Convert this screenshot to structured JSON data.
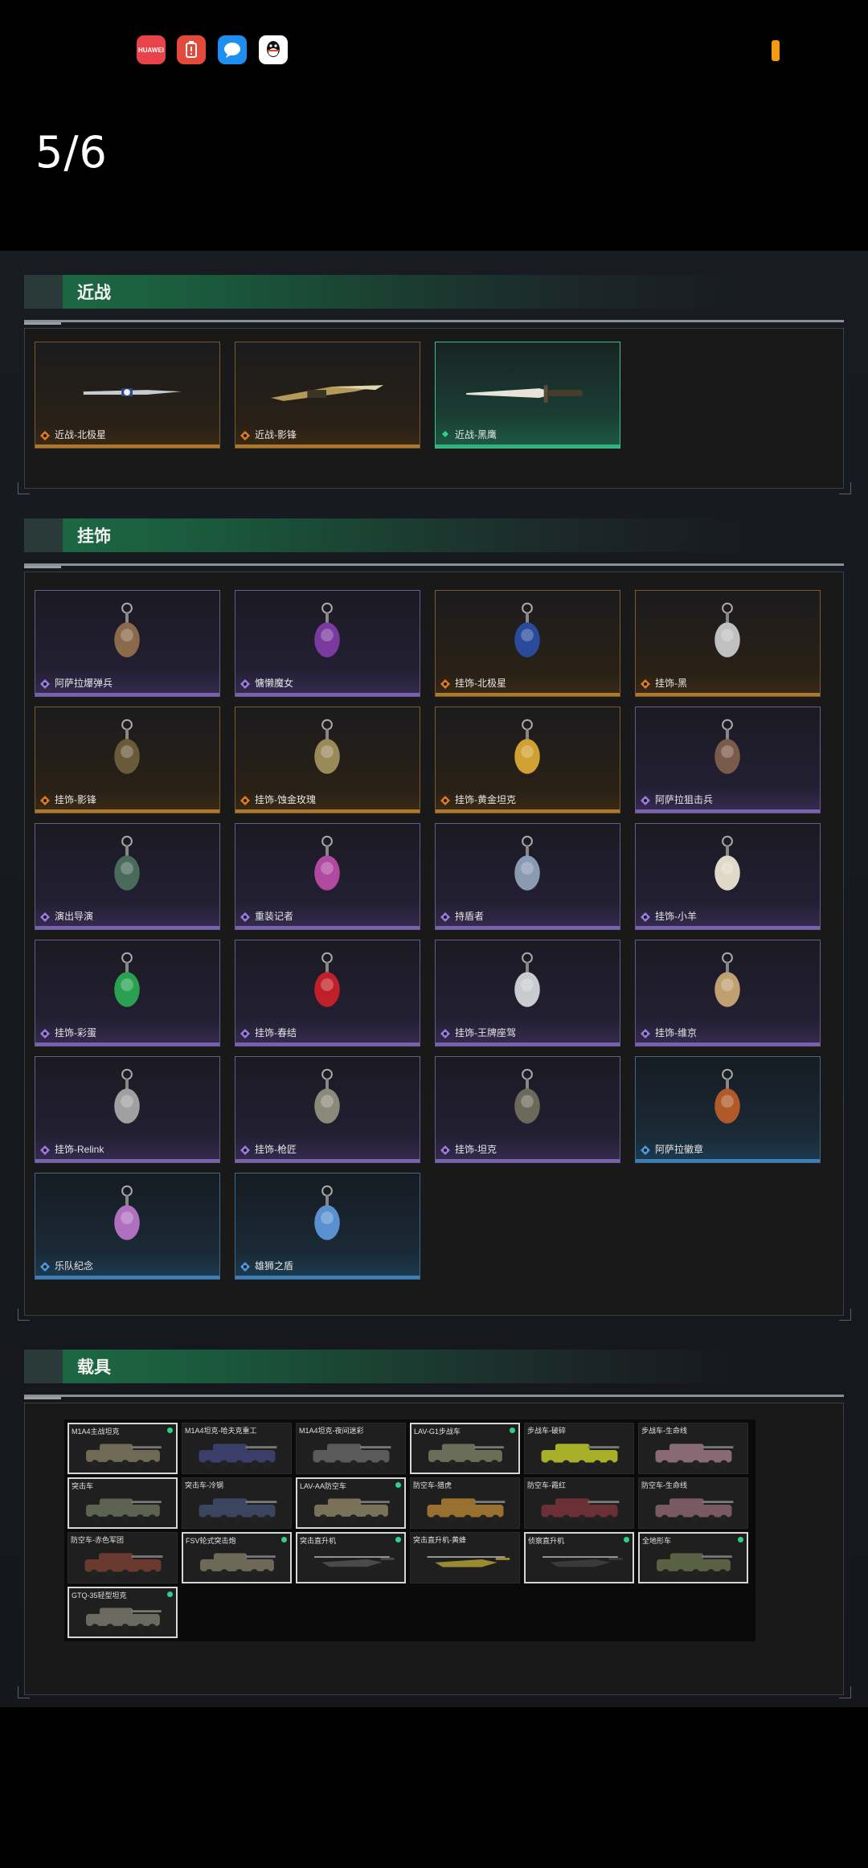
{
  "status_bar": {
    "icons": [
      {
        "name": "huawei-store-icon",
        "text": "HUAWEI",
        "color": "#e8424a"
      },
      {
        "name": "battery-alert-app-icon",
        "text": "",
        "color": "#e44a3c"
      },
      {
        "name": "messages-app-icon",
        "text": "",
        "color": "#1e8ff0"
      },
      {
        "name": "qq-app-icon",
        "text": "",
        "color": "#ffffff"
      }
    ],
    "battery_color": "#f39a12"
  },
  "page_counter": "5/6",
  "sections": {
    "melee": {
      "title": "近战",
      "items": [
        {
          "label": "近战-北极星",
          "rarity": "orange"
        },
        {
          "label": "近战-影锋",
          "rarity": "orange"
        },
        {
          "label": "近战-黑鹰",
          "rarity": "green"
        }
      ]
    },
    "charms": {
      "title": "挂饰",
      "items": [
        {
          "label": "阿萨拉爆弹兵",
          "rarity": "purple"
        },
        {
          "label": "慵懒魔女",
          "rarity": "purple"
        },
        {
          "label": "挂饰-北极星",
          "rarity": "orange"
        },
        {
          "label": "挂饰-黑",
          "rarity": "orange"
        },
        {
          "label": "挂饰-影锋",
          "rarity": "orange"
        },
        {
          "label": "挂饰-蚀金玫瑰",
          "rarity": "orange"
        },
        {
          "label": "挂饰-黄金坦克",
          "rarity": "orange"
        },
        {
          "label": "阿萨拉狙击兵",
          "rarity": "purple"
        },
        {
          "label": "演出导演",
          "rarity": "purple"
        },
        {
          "label": "重装记者",
          "rarity": "purple"
        },
        {
          "label": "持盾者",
          "rarity": "purple"
        },
        {
          "label": "挂饰-小羊",
          "rarity": "purple"
        },
        {
          "label": "挂饰-彩蛋",
          "rarity": "purple"
        },
        {
          "label": "挂饰-春结",
          "rarity": "purple"
        },
        {
          "label": "挂饰-王牌座驾",
          "rarity": "purple"
        },
        {
          "label": "挂饰-维京",
          "rarity": "purple"
        },
        {
          "label": "挂饰-Relink",
          "rarity": "purple"
        },
        {
          "label": "挂饰-枪匠",
          "rarity": "purple"
        },
        {
          "label": "挂饰-坦克",
          "rarity": "purple"
        },
        {
          "label": "阿萨拉徽章",
          "rarity": "blue"
        },
        {
          "label": "乐队纪念",
          "rarity": "blue"
        },
        {
          "label": "雄狮之盾",
          "rarity": "blue"
        }
      ]
    },
    "vehicles": {
      "title": "载具",
      "items": [
        {
          "label": "M1A4主战坦克",
          "dot": true,
          "selected": true,
          "tint": "#6e6a55"
        },
        {
          "label": "M1A4坦克-哈夫克重工",
          "dot": false,
          "selected": false,
          "tint": "#3a3f6a"
        },
        {
          "label": "M1A4坦克-夜间迷彩",
          "dot": false,
          "selected": false,
          "tint": "#5a5a5a"
        },
        {
          "label": "LAV-G1步战车",
          "dot": true,
          "selected": true,
          "tint": "#6a6e58"
        },
        {
          "label": "步战车-破碎",
          "dot": false,
          "selected": false,
          "tint": "#a8b02a"
        },
        {
          "label": "步战车-生命线",
          "dot": false,
          "selected": false,
          "tint": "#8a6a72"
        },
        {
          "label": "突击车",
          "dot": false,
          "selected": true,
          "tint": "#5e6250"
        },
        {
          "label": "突击车-冷钢",
          "dot": false,
          "selected": false,
          "tint": "#3a4660"
        },
        {
          "label": "LAV-AA防空车",
          "dot": true,
          "selected": true,
          "tint": "#7a7258"
        },
        {
          "label": "防空车-猎虎",
          "dot": false,
          "selected": false,
          "tint": "#9a7030"
        },
        {
          "label": "防空车-霞红",
          "dot": false,
          "selected": false,
          "tint": "#6a3036"
        },
        {
          "label": "防空车-生命线",
          "dot": false,
          "selected": false,
          "tint": "#7a5a62"
        },
        {
          "label": "防空车-赤色军团",
          "dot": false,
          "selected": false,
          "tint": "#6a3a30"
        },
        {
          "label": "FSV轮式突击炮",
          "dot": true,
          "selected": true,
          "tint": "#6e6858"
        },
        {
          "label": "突击直升机",
          "dot": true,
          "selected": true,
          "tint": "#4a4a48"
        },
        {
          "label": "突击直升机-黄蜂",
          "dot": false,
          "selected": false,
          "tint": "#9a8a30"
        },
        {
          "label": "侦察直升机",
          "dot": true,
          "selected": true,
          "tint": "#3a3a3a"
        },
        {
          "label": "全地形车",
          "dot": true,
          "selected": true,
          "tint": "#5a6044"
        },
        {
          "label": "GTQ-35轻型坦克",
          "dot": true,
          "selected": true,
          "tint": "#6a6a60"
        }
      ]
    }
  },
  "colors": {
    "accent_green": "#2fb37a",
    "rarity_orange": "#b0782a",
    "rarity_purple": "#7a62b0",
    "rarity_blue": "#3d7fb8"
  }
}
